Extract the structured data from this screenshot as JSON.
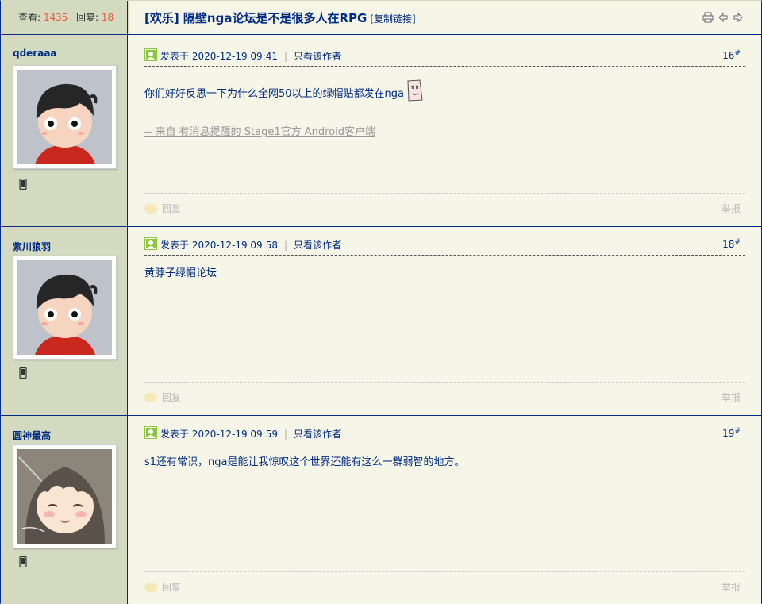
{
  "header": {
    "views_label": "查看:",
    "views_count": "1435",
    "replies_label": "回复:",
    "replies_count": "18",
    "thread_title": "[欢乐] 隔壁nga论坛是不是很多人在RPG",
    "copy_link": "[复制链接]",
    "icons": [
      "print-icon",
      "prev-thread-icon",
      "next-thread-icon"
    ]
  },
  "posts": [
    {
      "author": "qderaaa",
      "avatar": "cartoon-boy-avatar",
      "posted_label": "发表于",
      "timestamp": "2020-12-19 09:41",
      "only_author": "只看该作者",
      "floor": "16",
      "floor_mark": "#",
      "body": "你们好好反思一下为什么全网50以上的绿帽贴都发在nga",
      "emote": "smug-face-emoticon",
      "signature": "-- 来自 有消息提醒的 Stage1官方 Android客户端",
      "reply": "回复",
      "report": "举报"
    },
    {
      "author": "紫川狼羽",
      "avatar": "cartoon-boy-avatar",
      "posted_label": "发表于",
      "timestamp": "2020-12-19 09:58",
      "only_author": "只看该作者",
      "floor": "18",
      "floor_mark": "#",
      "body": "黄脖子绿帽论坛",
      "reply": "回复",
      "report": "举报"
    },
    {
      "author": "圆神最高",
      "avatar": "anime-girl-avatar",
      "posted_label": "发表于",
      "timestamp": "2020-12-19 09:59",
      "only_author": "只看该作者",
      "floor": "19",
      "floor_mark": "#",
      "body": "s1还有常识，nga是能让我惊叹这个世界还能有这么一群弱智的地方。",
      "reply": "回复",
      "report": "举报"
    }
  ],
  "colors": {
    "sidebar_bg": "#D3DAC0",
    "content_bg": "#F5F5E8",
    "link_blue": "#022C80",
    "count_red": "#E55A3C"
  }
}
